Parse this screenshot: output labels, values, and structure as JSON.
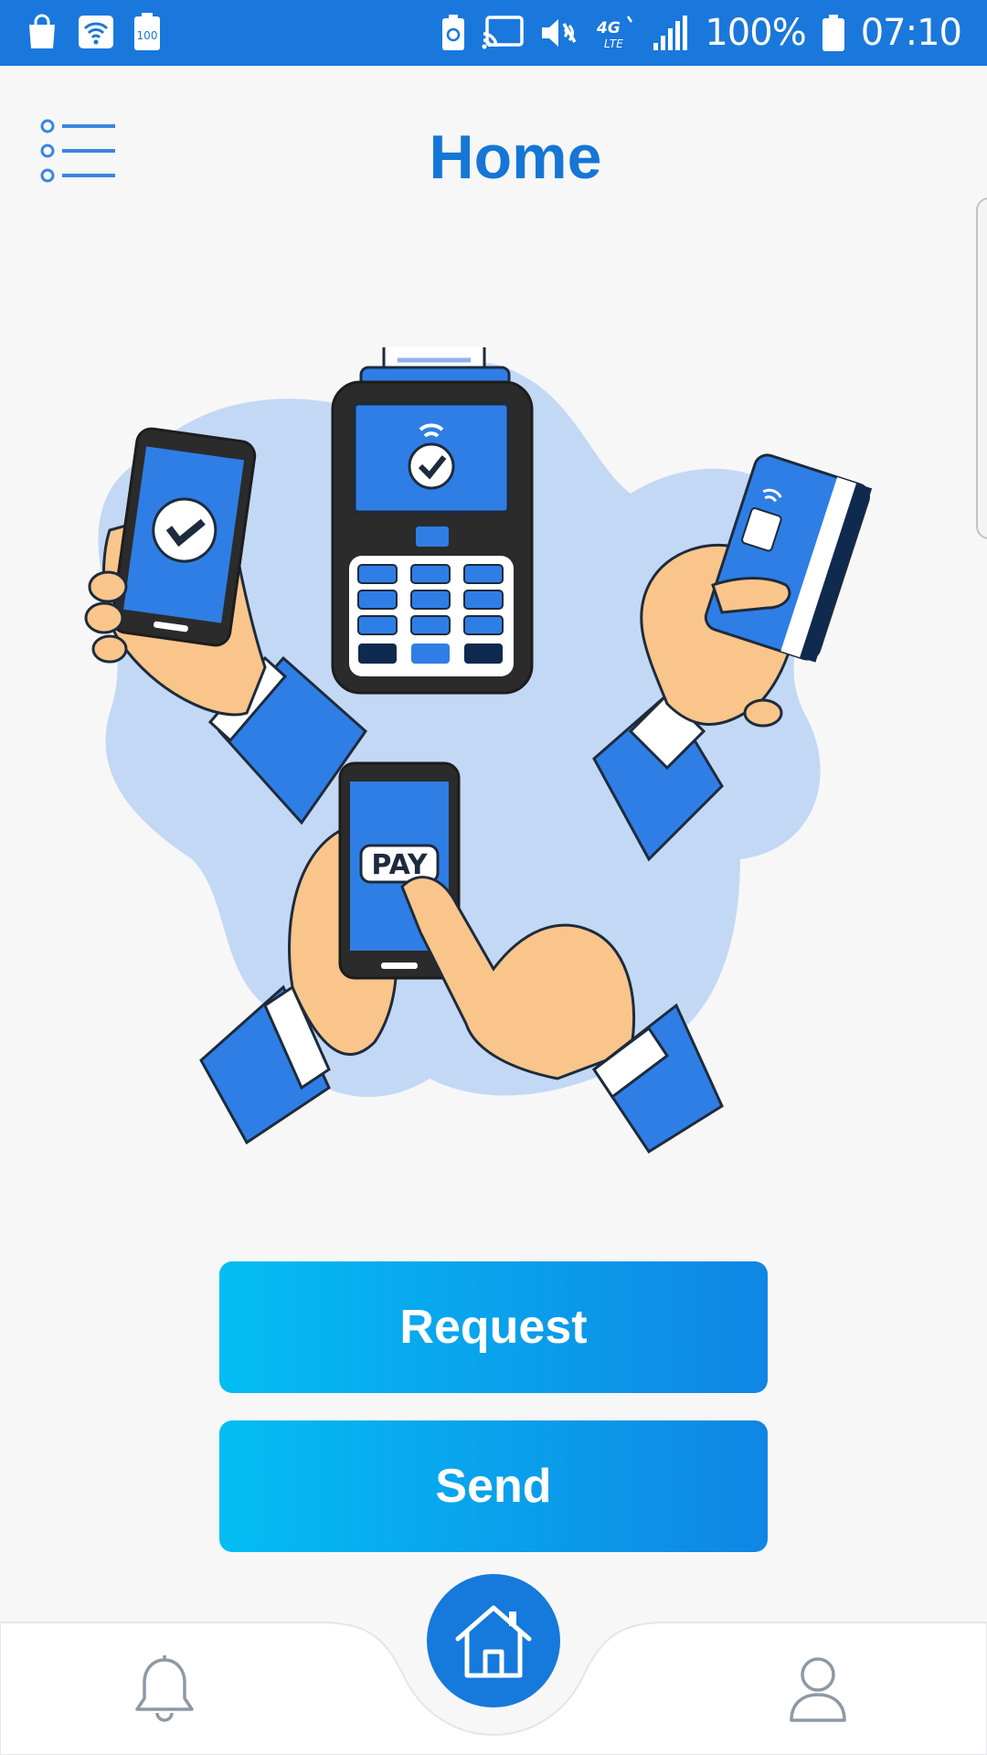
{
  "status_bar": {
    "icons_left": [
      "shopping-bag-icon",
      "wifi-icon",
      "battery-100-icon"
    ],
    "battery_small_label": "100",
    "icons_right": [
      "battery-saver-icon",
      "cast-icon",
      "mute-icon",
      "lte-icon",
      "signal-icon",
      "battery-icon"
    ],
    "network_label": "4G",
    "network_sub_label": "LTE",
    "battery_percent": "100%",
    "time": "07:10"
  },
  "header": {
    "title": "Home",
    "menu_icon": "list-menu-icon"
  },
  "illustration": {
    "pay_label": "PAY"
  },
  "actions": {
    "request_label": "Request",
    "send_label": "Send"
  },
  "bottom_nav": {
    "items": [
      {
        "icon": "bell-icon"
      },
      {
        "icon": "home-icon",
        "active": true
      },
      {
        "icon": "profile-icon"
      }
    ]
  },
  "colors": {
    "primary": "#1a78dc",
    "title": "#1576d6",
    "button_gradient_start": "#04bdf4",
    "button_gradient_end": "#0f86e4",
    "illustration_blob": "#c3d8f5",
    "skin": "#f9c58a",
    "device_dark": "#2b2b2b",
    "screen_blue": "#2f7ee6"
  }
}
